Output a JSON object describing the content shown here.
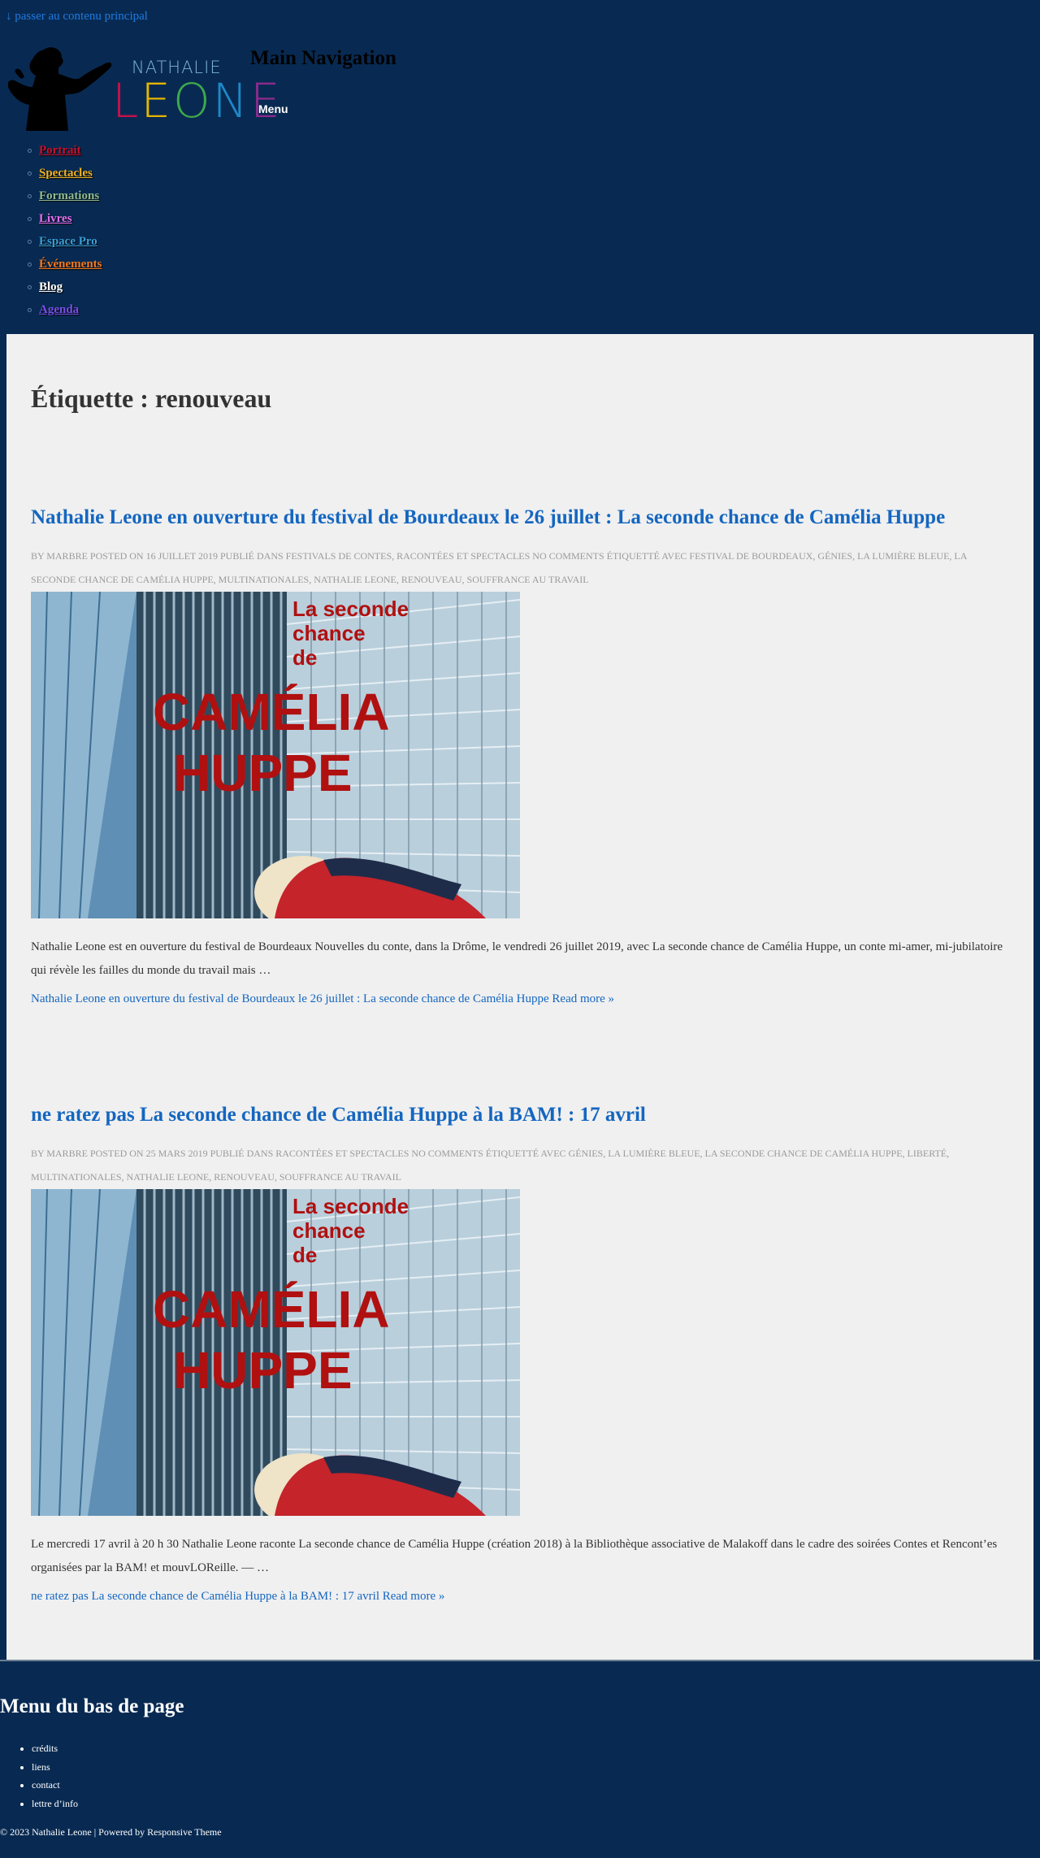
{
  "skip_link": "↓ passer au contenu principal",
  "logo": {
    "first_name": "NATHALIE",
    "last_name": "LEONE",
    "last_name_colors": [
      "#c8104c",
      "#e5b400",
      "#3fa94a",
      "#1e88c8",
      "#8e2a8e"
    ]
  },
  "header": {
    "main_nav_title": "Main Navigation",
    "menu_label": "Menu"
  },
  "nav": {
    "items": [
      {
        "label": "Portrait",
        "color": "#c8102e"
      },
      {
        "label": "Spectacles",
        "color": "#f2b21c"
      },
      {
        "label": "Formations",
        "color": "#8fbc8f"
      },
      {
        "label": "Livres",
        "color": "#e66ff0"
      },
      {
        "label": "Espace Pro",
        "color": "#3a9fd6"
      },
      {
        "label": "Événements",
        "color": "#f27a1e"
      },
      {
        "label": "Blog",
        "color": "#ffffff"
      },
      {
        "label": "Agenda",
        "color": "#7a4fe8"
      }
    ]
  },
  "page_title": "Étiquette : renouveau",
  "posts": [
    {
      "title": "Nathalie Leone en ouverture du festival de Bourdeaux le 26 juillet : La seconde chance de Camélia Huppe",
      "meta": "By marbre Posted on 16 juillet 2019 Publié dans Festivals de contes, racontées et spectacles No Comments Étiquetté avec festival de bourdeaux, génies, la lumière bleue, la seconde chance de camélia huppe, multinationales, nathalie leone, renouveau, souffrance au travail",
      "image": {
        "line1": "La seconde",
        "line2": "chance",
        "line3": "de",
        "line4": "CAMÉLIA",
        "line5": "HUPPE"
      },
      "excerpt": "Nathalie Leone est en ouverture du festival de Bourdeaux Nouvelles du conte, dans la Drôme, le vendredi 26 juillet 2019, avec La seconde chance de Camélia Huppe, un conte mi-amer, mi-jubilatoire qui révèle les failles du monde du travail mais …",
      "read_more": "Nathalie Leone en ouverture du festival de Bourdeaux le 26 juillet : La seconde chance de Camélia Huppe Read more »"
    },
    {
      "title": "ne ratez pas La seconde chance de Camélia Huppe à la BAM! : 17 avril",
      "meta": "By marbre Posted on 25 mars 2019 Publié dans racontées et spectacles No Comments Étiquetté avec génies, la lumière bleue, la seconde chance de camélia huppe, liberté, multinationales, nathalie leone, renouveau, souffrance au travail",
      "image": {
        "line1": "La seconde",
        "line2": "chance",
        "line3": "de",
        "line4": "CAMÉLIA",
        "line5": "HUPPE"
      },
      "excerpt": "Le mercredi 17 avril à 20 h 30 Nathalie Leone raconte La seconde chance de Camélia Huppe (création 2018) à la Bibliothèque associative de Malakoff dans le cadre des soirées Contes et Rencont’es organisées par la BAM! et mouvLOReille. — …",
      "read_more": "ne ratez pas La seconde chance de Camélia Huppe à la BAM! : 17 avril Read more »"
    }
  ],
  "footer": {
    "title": "Menu du bas de page",
    "links": [
      "crédits",
      "liens",
      "contact",
      "lettre d’info"
    ],
    "copyright": "© 2023 Nathalie Leone | Powered by Responsive Theme"
  }
}
